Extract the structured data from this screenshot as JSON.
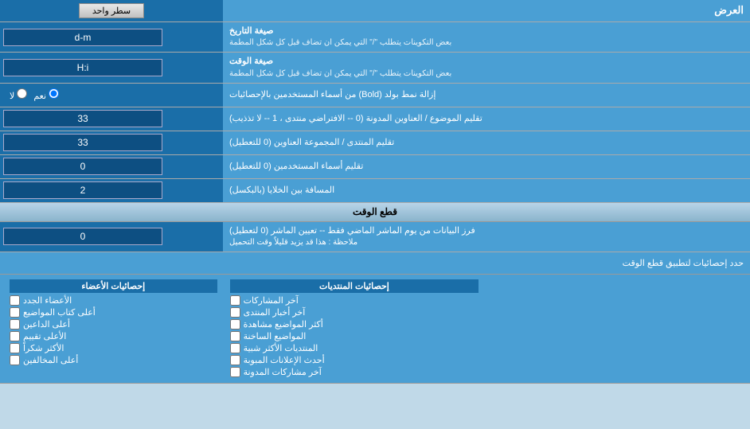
{
  "header": {
    "title": "العرض",
    "dropdown_label": "سطر واحد"
  },
  "rows": [
    {
      "id": "date_format",
      "label": "صيغة التاريخ",
      "sublabel": "بعض التكوينات يتطلب \"/\" التي يمكن ان تضاف قبل كل شكل المطمة",
      "value": "d-m"
    },
    {
      "id": "time_format",
      "label": "صيغة الوقت",
      "sublabel": "بعض التكوينات يتطلب \"/\" التي يمكن ان تضاف قبل كل شكل المطمة",
      "value": "H:i"
    },
    {
      "id": "bold_remove",
      "label": "إزالة نمط بولد (Bold) من أسماء المستخدمين بالإحصائيات",
      "radio_yes": "نعم",
      "radio_no": "لا",
      "selected": "نعم"
    },
    {
      "id": "topics_trim",
      "label": "تقليم الموضوع / العناوين المدونة (0 -- الافتراضي منتدى ، 1 -- لا تذذيب)",
      "value": "33"
    },
    {
      "id": "forum_trim",
      "label": "تقليم المنتدى / المجموعة العناوين (0 للتعطيل)",
      "value": "33"
    },
    {
      "id": "username_trim",
      "label": "تقليم أسماء المستخدمين (0 للتعطيل)",
      "value": "0"
    },
    {
      "id": "cell_spacing",
      "label": "المسافة بين الخلايا (بالبكسل)",
      "value": "2"
    }
  ],
  "cut_section": {
    "title": "قطع الوقت",
    "label": "فرز البيانات من يوم الماشر الماضي فقط -- تعيين الماشر (0 لتعطيل)",
    "note": "ملاحظة : هذا قد يزيد قليلاً وقت التحميل",
    "value": "0",
    "limit_label": "حدد إحصائيات لتطبيق قطع الوقت"
  },
  "checkbox_sections": {
    "col1_header": "إحصائيات الأعضاء",
    "col1_items": [
      "الأعضاء الجدد",
      "أعلى كتاب المواضيع",
      "أعلى الداعين",
      "الأعلى تقييم",
      "الأكثر شكراً",
      "أعلى المخالفين"
    ],
    "col2_header": "إحصائيات المنتديات",
    "col2_items": [
      "آخر المشاركات",
      "آخر أخبار المنتدى",
      "أكثر المواضيع مشاهدة",
      "المواضيع الساخنة",
      "المنتديات الأكثر شبية",
      "أحدث الإعلانات المبوبة",
      "آخر مشاركات المدونة"
    ]
  }
}
